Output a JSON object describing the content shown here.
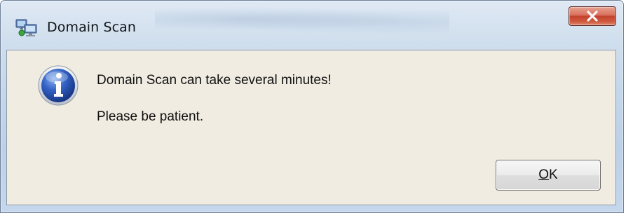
{
  "window": {
    "title": "Domain Scan",
    "title_icon": "domain-scan-app-icon",
    "close_icon": "close-icon"
  },
  "dialog": {
    "icon": "info-icon",
    "message_line1": "Domain Scan can take several minutes!",
    "message_line2": "Please be patient.",
    "ok_button": {
      "mnemonic": "O",
      "rest": "K"
    }
  },
  "colors": {
    "client_background": "#f0ece1",
    "close_button": "#c2422d",
    "info_icon": "#1f4aa8"
  }
}
